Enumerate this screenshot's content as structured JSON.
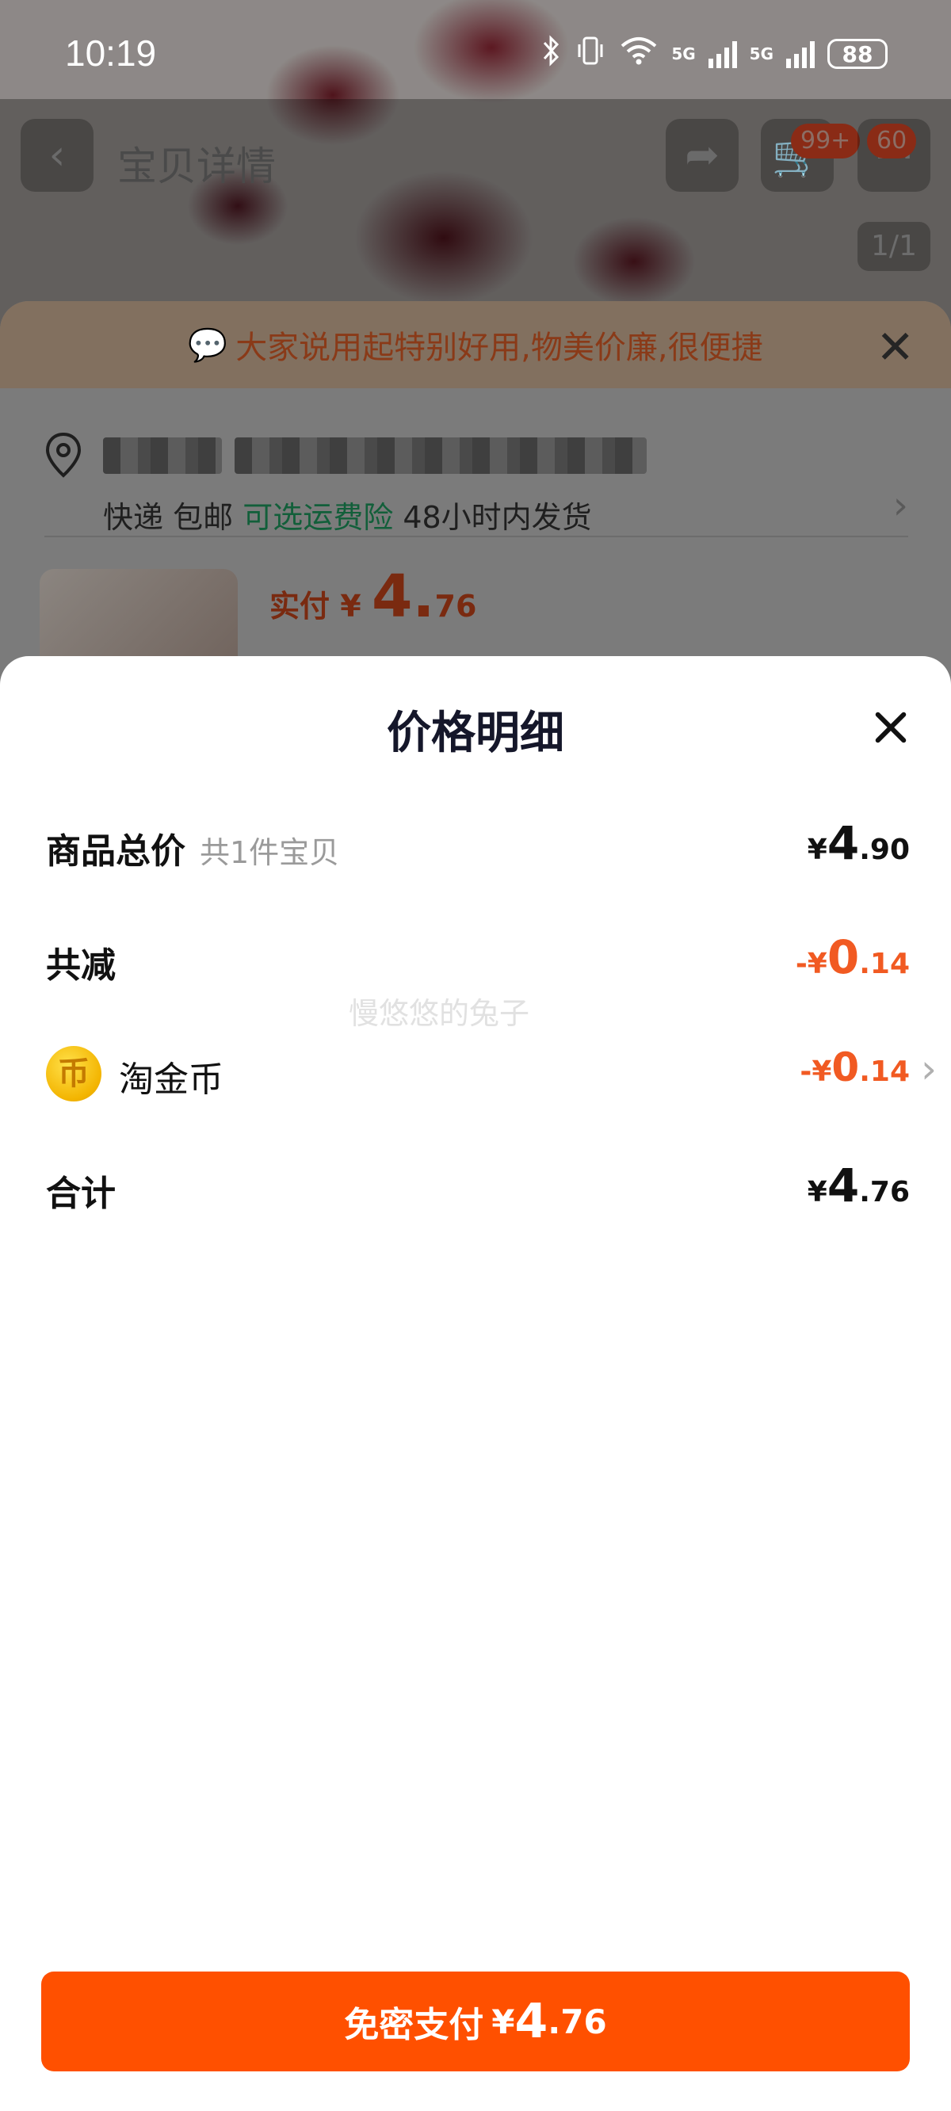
{
  "status_bar": {
    "time": "10:19",
    "network_1": "5G",
    "network_2": "5G",
    "battery": "88"
  },
  "background": {
    "nav_title": "宝贝详情",
    "cart_badge": "99+",
    "msg_badge": "60",
    "page_indicator": "1/1",
    "tip_text": "大家说用起特别好用,物美价廉,很便捷",
    "address_tags": {
      "express": "快递",
      "free_ship": "包邮",
      "insurance": "可选运费险",
      "ship_time": "48小时内发货"
    },
    "product_price": {
      "label": "实付",
      "currency": "¥",
      "int": "4.",
      "dec": "76"
    }
  },
  "sheet": {
    "title": "价格明细",
    "rows": {
      "subtotal": {
        "label": "商品总价",
        "sub": "共1件宝贝",
        "currency": "¥",
        "int": "4",
        "dec": ".90"
      },
      "discount": {
        "label": "共减",
        "currency": "-¥",
        "int": "0",
        "dec": ".14"
      },
      "coins": {
        "icon_glyph": "币",
        "label": "淘金币",
        "currency": "-¥",
        "int": "0",
        "dec": ".14"
      },
      "total": {
        "label": "合计",
        "currency": "¥",
        "int": "4",
        "dec": ".76"
      }
    },
    "watermark": "慢悠悠的兔子",
    "pay_button": {
      "label": "免密支付",
      "currency": "¥",
      "int": "4",
      "dec": ".76"
    }
  },
  "colors": {
    "accent": "#ff5000",
    "discount": "#f15a22"
  }
}
